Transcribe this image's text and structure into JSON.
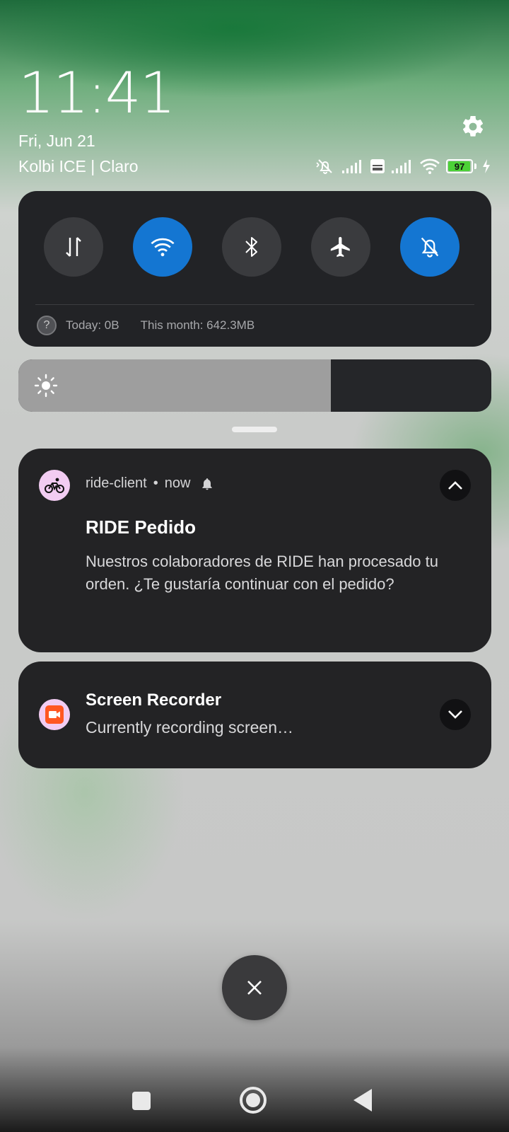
{
  "header": {
    "time": "11:41",
    "date": "Fri, Jun 21",
    "carriers": "Kolbi ICE | Claro",
    "battery_level": "97",
    "battery_fraction": 0.97,
    "settings_icon": "gear-icon",
    "status_icons": [
      "mute-icon",
      "signal-icon",
      "volte-icon",
      "signal-icon",
      "wifi-icon",
      "battery-icon",
      "charging-icon"
    ]
  },
  "quick_settings": {
    "toggles": [
      {
        "name": "mobile-data",
        "icon": "data-arrows-icon",
        "active": false
      },
      {
        "name": "wifi",
        "icon": "wifi-icon",
        "active": true
      },
      {
        "name": "bluetooth",
        "icon": "bluetooth-icon",
        "active": false
      },
      {
        "name": "airplane-mode",
        "icon": "airplane-icon",
        "active": false
      },
      {
        "name": "silent",
        "icon": "bell-off-icon",
        "active": true
      }
    ],
    "data_today": "Today: 0B",
    "data_month": "This month: 642.3MB",
    "accent_color": "#1476d2"
  },
  "brightness": {
    "level": 0.66,
    "icon": "sun-icon"
  },
  "notifications": [
    {
      "app": "ride-client",
      "time": "now",
      "separator": "•",
      "title": "RIDE Pedido",
      "body": "Nuestros colaboradores de RIDE han procesado tu orden. ¿Te gustaría continuar con el pedido?",
      "expanded": true,
      "icon": "bicycle-icon"
    },
    {
      "app": "Screen Recorder",
      "title": "Screen Recorder",
      "body": "Currently recording screen…",
      "expanded": false,
      "icon": "video-camera-icon",
      "icon_color": "#ff5722"
    }
  ],
  "controls": {
    "clear_icon": "close-icon",
    "nav": [
      "recents-icon",
      "home-icon",
      "back-icon"
    ]
  }
}
